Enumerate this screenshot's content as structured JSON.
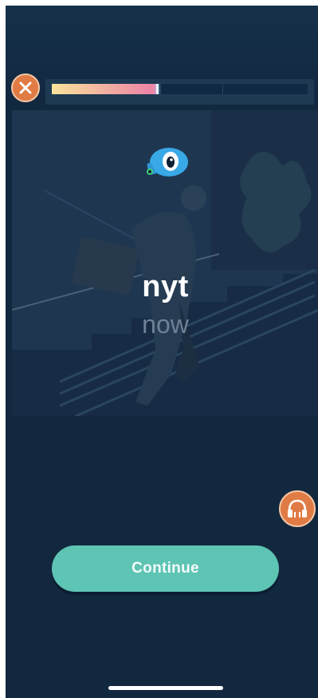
{
  "lesson": {
    "word": "nyt",
    "translation": "now",
    "progress_fraction": 0.41
  },
  "buttons": {
    "continue_label": "Continue"
  },
  "icons": {
    "close": "close-icon",
    "audio": "headphones-icon",
    "mascot": "mascot-icon"
  },
  "colors": {
    "background": "#12283f",
    "accent_orange": "#e07b45",
    "continue_teal": "#5ec4b4",
    "progress_start": "#f9e39a",
    "progress_end": "#ec7fa7"
  }
}
